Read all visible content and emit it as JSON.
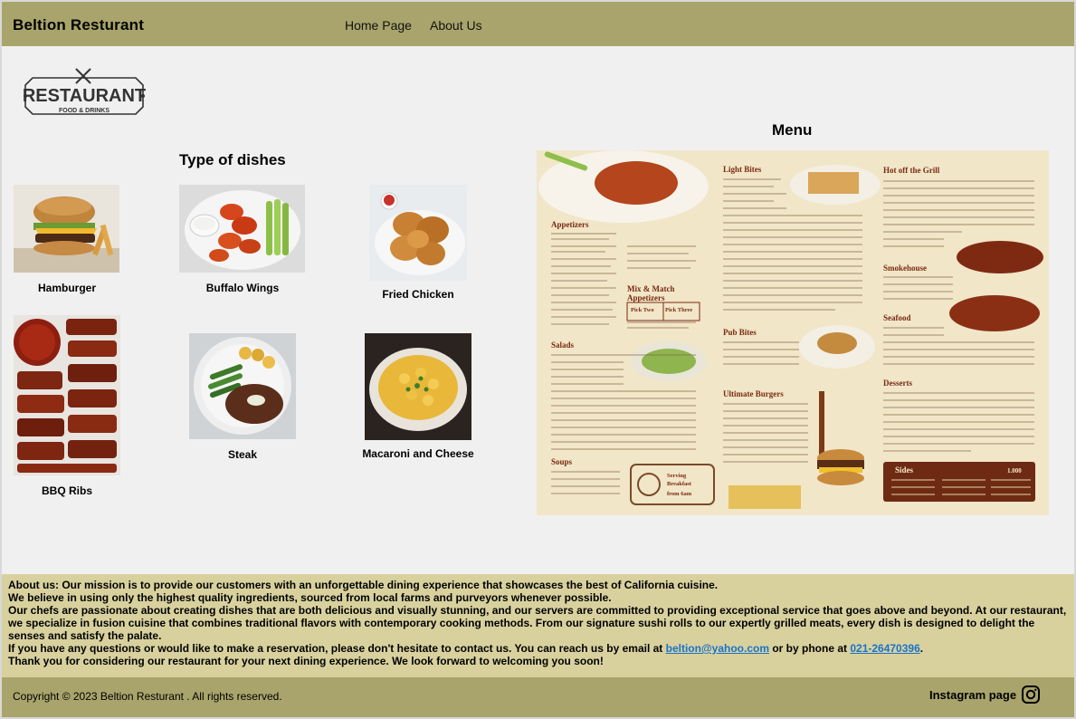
{
  "header": {
    "brand": "Beltion Resturant",
    "nav": {
      "home": "Home Page",
      "about": "About Us"
    }
  },
  "logo": {
    "main": "RESTAURANT",
    "sub": "FOOD & DRINKS"
  },
  "dishes": {
    "title": "Type of dishes",
    "items": [
      {
        "label": "Hamburger"
      },
      {
        "label": "Buffalo Wings"
      },
      {
        "label": "Fried Chicken"
      },
      {
        "label": "BBQ Ribs"
      },
      {
        "label": "Steak"
      },
      {
        "label": "Macaroni and Cheese"
      }
    ]
  },
  "menu": {
    "title": "Menu",
    "sections": {
      "light_bites": "Light Bites",
      "hot_grill": "Hot off the Grill",
      "appetizers": "Appetizers",
      "mix_match": "Mix & Match",
      "mix_match_2": "Appetizers",
      "pick_two": "Pick Two",
      "pick_three": "Pick Three",
      "smokehouse": "Smokehouse",
      "seafood": "Seafood",
      "pub_bites": "Pub Bites",
      "salads": "Salads",
      "desserts": "Desserts",
      "ultimate_burgers": "Ultimate Burgers",
      "soups": "Soups",
      "sides": "Sides",
      "sides_price": "1.000",
      "serving_1": "Serving",
      "serving_2": "Breakfast",
      "serving_3": "from 6am"
    }
  },
  "about": {
    "lead": "About us:",
    "line1": " Our mission is to provide our customers with an unforgettable dining experience that showcases the best of California cuisine.",
    "line2": "We believe in using only the highest quality ingredients, sourced from local farms and purveyors whenever possible.",
    "line3": "Our chefs are passionate about creating dishes that are both delicious and visually stunning, and our servers are committed to providing exceptional service that goes above and beyond. At our restaurant, we specialize in fusion cuisine that combines traditional flavors with contemporary cooking methods. From our signature sushi rolls to our expertly grilled meats, every dish is designed to delight the senses and satisfy the palate.",
    "line4_pre": "If you have any questions or would like to make a reservation, please don't hesitate to contact us. You can reach us by email at ",
    "email": "beltion@yahoo.com",
    "line4_mid": " or by phone at ",
    "phone": "021-26470396",
    "line4_end": ".",
    "line5": "Thank you for considering our restaurant for your next dining experience. We look forward to welcoming you soon!"
  },
  "footer": {
    "copyright": "Copyright © 2023 Beltion Resturant . All rights reserved.",
    "instagram": "Instagram page"
  },
  "colors": {
    "bar": "#a9a46b",
    "about_bg": "#d8d19e",
    "link": "#1a73c9",
    "page_bg": "#f0f0f0"
  }
}
